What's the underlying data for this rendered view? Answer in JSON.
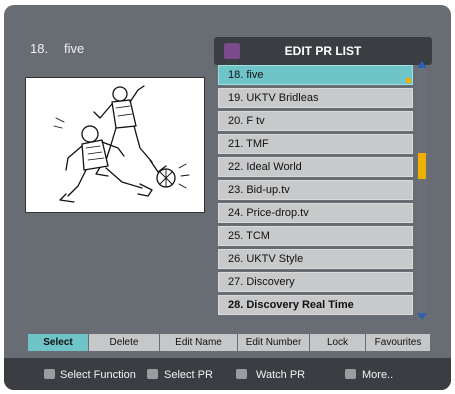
{
  "current": {
    "number": "18.",
    "name": "five"
  },
  "header": {
    "title": "EDIT PR LIST",
    "icon": "tv-icon"
  },
  "channels": [
    {
      "label": "18. five",
      "selected": true
    },
    {
      "label": "19. UKTV Bridleas"
    },
    {
      "label": "20. F tv"
    },
    {
      "label": "21. TMF"
    },
    {
      "label": "22. Ideal World"
    },
    {
      "label": "23. Bid-up.tv"
    },
    {
      "label": "24. Price-drop.tv"
    },
    {
      "label": "25. TCM"
    },
    {
      "label": "26. UKTV Style"
    },
    {
      "label": "27. Discovery"
    },
    {
      "label": "28. Discovery Real Time",
      "bold": true
    }
  ],
  "functions": [
    {
      "label": "Select",
      "active": true
    },
    {
      "label": "Delete"
    },
    {
      "label": "Edit Name"
    },
    {
      "label": "Edit Number"
    },
    {
      "label": "Lock"
    },
    {
      "label": "Favourites"
    }
  ],
  "hints": [
    {
      "label": "Select Function",
      "icon": "left-right-arrows-icon"
    },
    {
      "label": "Select PR",
      "icon": "up-down-arrows-icon"
    },
    {
      "label": "Watch PR",
      "icon": "ok-button-icon"
    },
    {
      "label": "More..",
      "icon": "menu-button-icon"
    }
  ],
  "colors": {
    "selection": "#6fc4c8",
    "scroll_thumb": "#f0b000",
    "background": "#686d73"
  }
}
